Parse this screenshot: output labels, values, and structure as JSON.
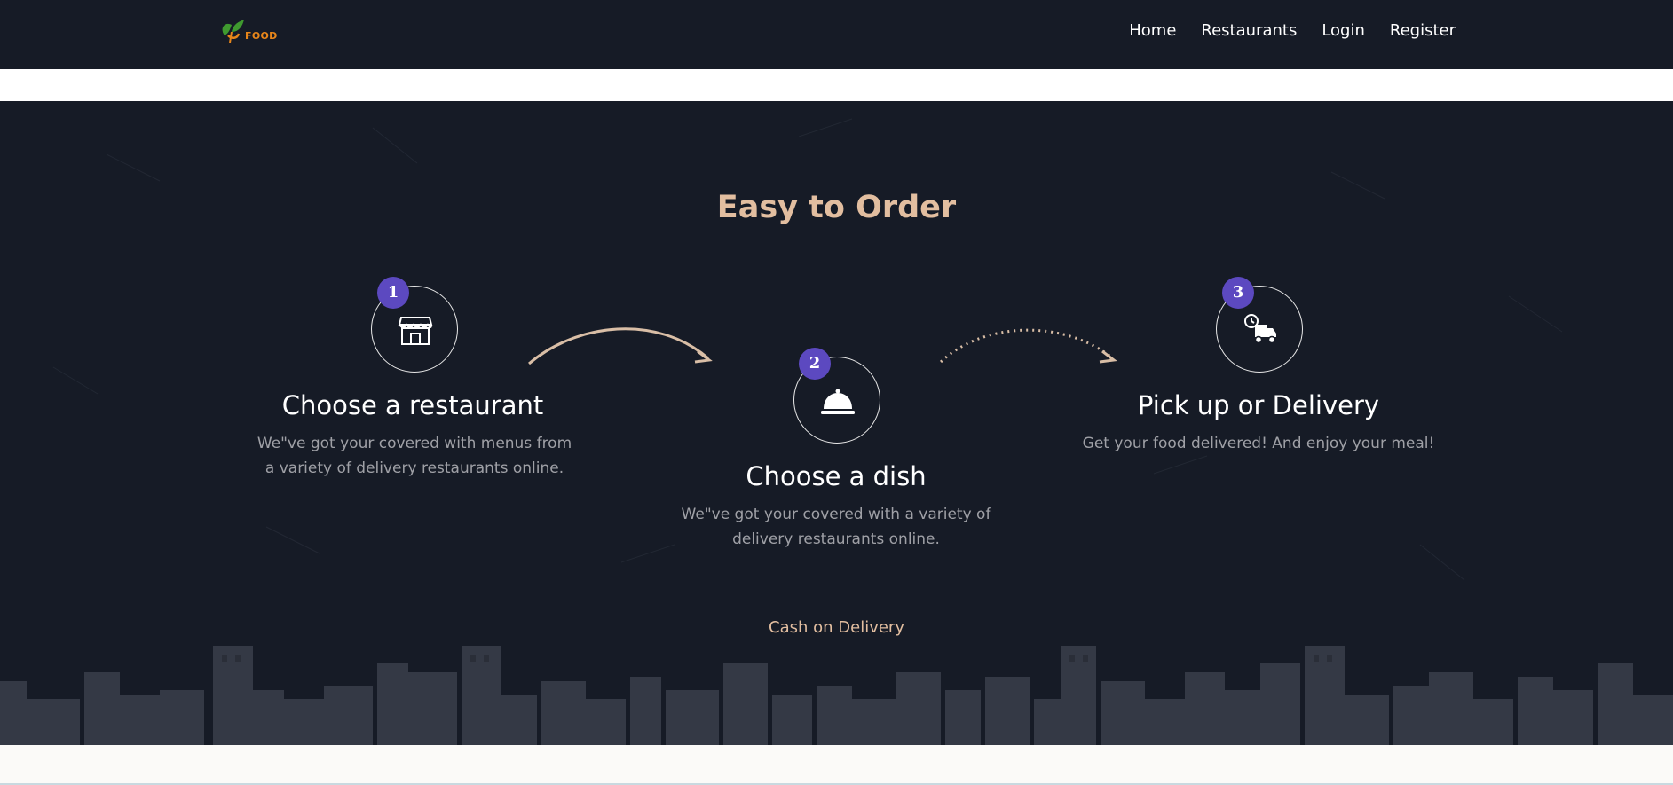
{
  "header": {
    "logo_text": "FOOD",
    "nav": [
      {
        "label": "Home"
      },
      {
        "label": "Restaurants"
      },
      {
        "label": "Login"
      },
      {
        "label": "Register"
      }
    ]
  },
  "hero": {
    "title": "Easy to Order",
    "steps": [
      {
        "number": "1",
        "icon": "storefront-icon",
        "title": "Choose a restaurant",
        "description": "We\"ve got your covered with menus from a variety of delivery restaurants online."
      },
      {
        "number": "2",
        "icon": "cloche-icon",
        "title": "Choose a dish",
        "description": "We\"ve got your covered with a variety of delivery restaurants online."
      },
      {
        "number": "3",
        "icon": "delivery-truck-icon",
        "title": "Pick up or Delivery",
        "description": "Get your food delivered! And enjoy your meal!"
      }
    ],
    "payment_note": "Cash on Delivery"
  },
  "colors": {
    "background": "#161b26",
    "accent": "#e2bea0",
    "badge": "#5c49c0",
    "logo_orange": "#e8861a",
    "logo_green": "#3f9a2f"
  }
}
